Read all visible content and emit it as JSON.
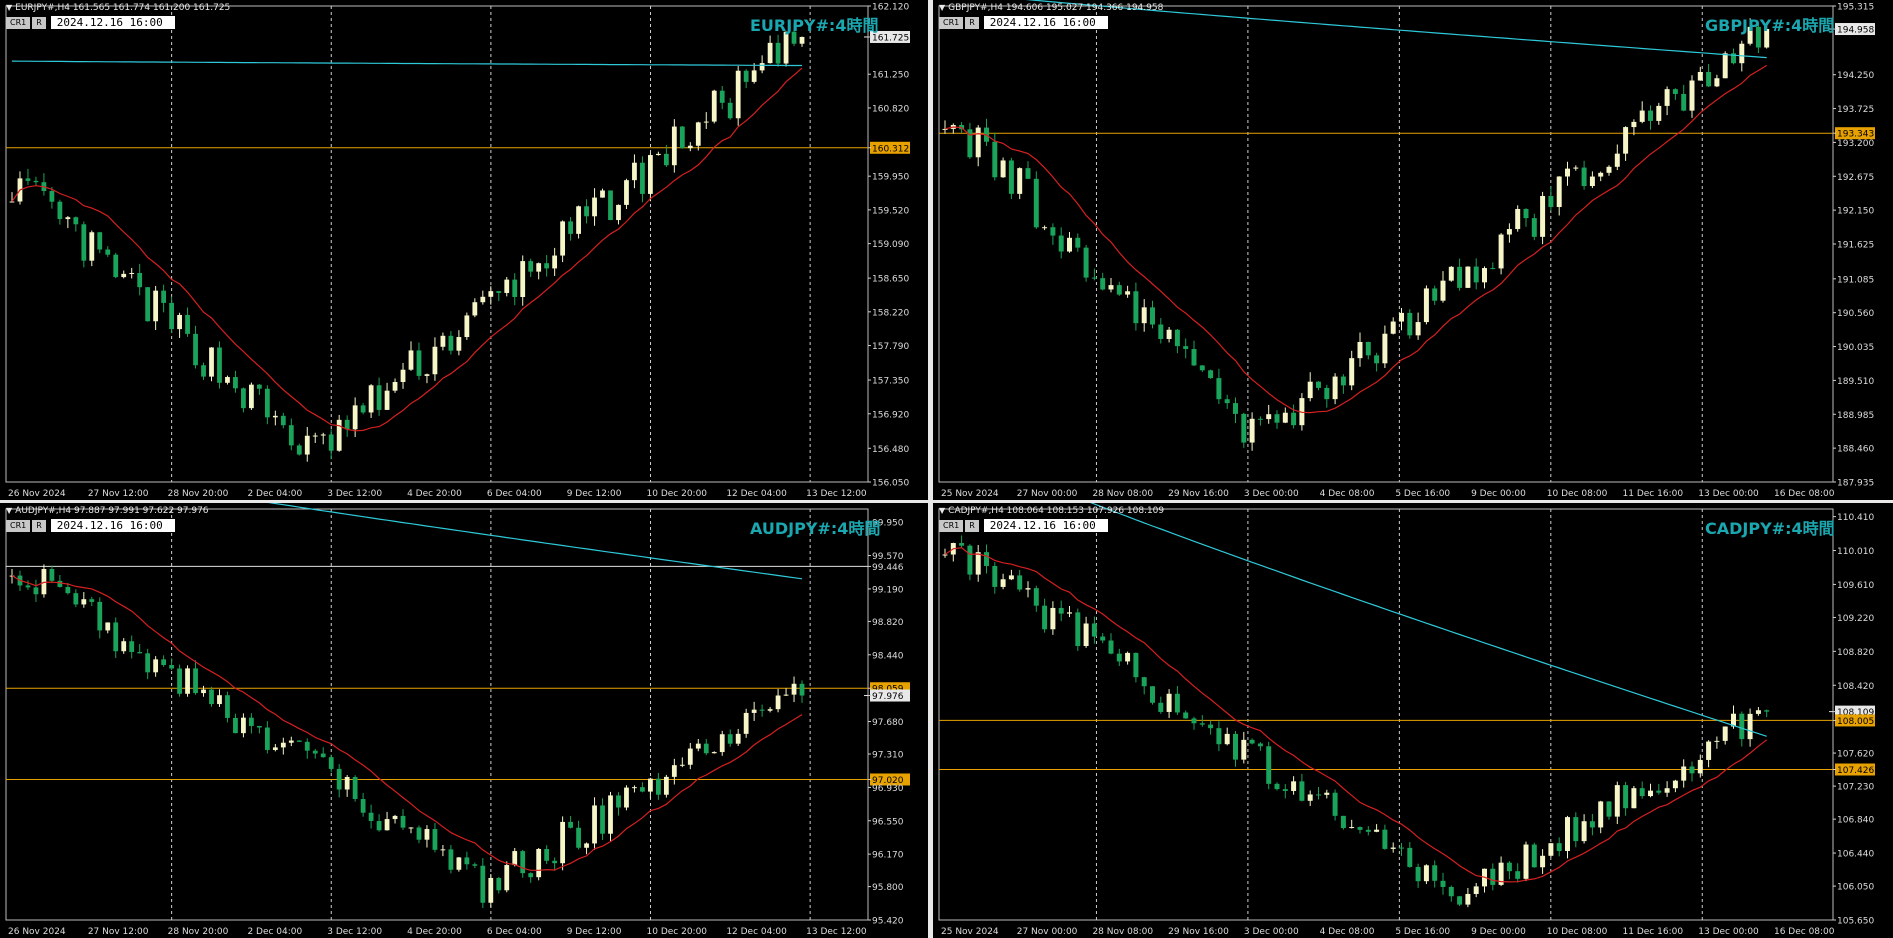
{
  "colors": {
    "up": "#f6f6c8",
    "down": "#1aa35a",
    "ma_fast": "#d62020",
    "ma_slow": "#2ec9d9",
    "hline": "#e8a200",
    "hline_white": "#e0e0e0",
    "grid": "#cfcfcf",
    "title": "#1aa7b0"
  },
  "panels": [
    {
      "id": "eurjpy",
      "ohlc": "EURJPY#,H4  161.565 161.774 161.200 161.725",
      "tag1": "CR1",
      "tag2": "R",
      "date": "2024.12.16 16:00",
      "title": "EURJPY#:4時間",
      "price_labels": [
        "162.120",
        "161.725",
        "161.250",
        "160.820",
        "160.312",
        "159.950",
        "159.520",
        "159.090",
        "158.650",
        "158.220",
        "157.790",
        "157.350",
        "156.920",
        "156.480",
        "156.050"
      ],
      "time_labels": [
        "26 Nov 2024",
        "27 Nov 12:00",
        "28 Nov 20:00",
        "2 Dec 04:00",
        "3 Dec 12:00",
        "4 Dec 20:00",
        "6 Dec 04:00",
        "9 Dec 12:00",
        "10 Dec 20:00",
        "12 Dec 04:00",
        "13 Dec 12:00"
      ],
      "current": "161.725",
      "hline": "160.312",
      "chart_data": {
        "type": "candlestick",
        "ylim": [
          156.05,
          162.12
        ],
        "last": 161.725,
        "hlines": [
          160.312
        ],
        "start": 159.9,
        "end": 161.725,
        "low_idx": 0.38,
        "low": 156.4
      }
    },
    {
      "id": "gbpjpy",
      "ohlc": "GBPJPY#,H4  194.606 195.027 194.366 194.958",
      "tag1": "CR1",
      "tag2": "R",
      "date": "2024.12.16 16:00",
      "title": "GBPJPY#:4時間",
      "price_labels": [
        "195.315",
        "194.958",
        "194.250",
        "193.725",
        "193.343",
        "193.200",
        "192.675",
        "192.150",
        "191.625",
        "191.085",
        "190.560",
        "190.035",
        "189.510",
        "188.985",
        "188.460",
        "187.935"
      ],
      "time_labels": [
        "25 Nov 2024",
        "27 Nov 00:00",
        "28 Nov 08:00",
        "29 Nov 16:00",
        "3 Dec 00:00",
        "4 Dec 08:00",
        "5 Dec 16:00",
        "9 Dec 00:00",
        "10 Dec 08:00",
        "11 Dec 16:00",
        "13 Dec 00:00",
        "16 Dec 08:00"
      ],
      "current": "194.958",
      "hline": "193.343",
      "chart_data": {
        "type": "candlestick",
        "ylim": [
          187.935,
          195.315
        ],
        "last": 194.958,
        "hlines": [
          193.343
        ],
        "start": 193.7,
        "end": 194.958,
        "low_idx": 0.38,
        "low": 188.6
      }
    },
    {
      "id": "audjpy",
      "ohlc": "AUDJPY#,H4  97.887 97.991 97.622 97.976",
      "tag1": "CR1",
      "tag2": "R",
      "date": "2024.12.16 16:00",
      "title": "AUDJPY#:4時間",
      "price_labels": [
        "99.950",
        "99.570",
        "99.446",
        "99.190",
        "98.820",
        "98.440",
        "98.059",
        "97.976",
        "97.680",
        "97.310",
        "97.020",
        "96.930",
        "96.550",
        "96.170",
        "95.800",
        "95.420"
      ],
      "time_labels": [
        "26 Nov 2024",
        "27 Nov 12:00",
        "28 Nov 20:00",
        "2 Dec 04:00",
        "3 Dec 12:00",
        "4 Dec 20:00",
        "6 Dec 04:00",
        "9 Dec 12:00",
        "10 Dec 20:00",
        "12 Dec 04:00",
        "13 Dec 12:00"
      ],
      "current": "97.976",
      "hline": "98.059",
      "hline2": "97.020",
      "hline_white": "99.446",
      "chart_data": {
        "type": "candlestick",
        "ylim": [
          95.42,
          100.1
        ],
        "last": 97.976,
        "hlines": [
          98.059,
          97.02,
          99.446
        ],
        "start": 99.5,
        "end": 97.976,
        "low_idx": 0.6,
        "low": 95.8
      }
    },
    {
      "id": "cadjpy",
      "ohlc": "CADJPY#,H4  108.064 108.153 107.926 108.109",
      "tag1": "CR1",
      "tag2": "R",
      "date": "2024.12.16 16:00",
      "title": "CADJPY#:4時間",
      "price_labels": [
        "110.410",
        "110.010",
        "109.610",
        "109.220",
        "108.820",
        "108.420",
        "108.109",
        "108.005",
        "107.620",
        "107.426",
        "107.230",
        "106.840",
        "106.440",
        "106.050",
        "105.650"
      ],
      "time_labels": [
        "25 Nov 2024",
        "27 Nov 00:00",
        "28 Nov 08:00",
        "29 Nov 16:00",
        "3 Dec 00:00",
        "4 Dec 08:00",
        "5 Dec 16:00",
        "9 Dec 00:00",
        "10 Dec 08:00",
        "11 Dec 16:00",
        "13 Dec 00:00",
        "16 Dec 08:00"
      ],
      "current": "108.109",
      "hline": "108.005",
      "hline2": "107.426",
      "chart_data": {
        "type": "candlestick",
        "ylim": [
          105.65,
          110.5
        ],
        "last": 108.109,
        "hlines": [
          108.005,
          107.426
        ],
        "start": 110.1,
        "end": 108.109,
        "low_idx": 0.62,
        "low": 105.9
      }
    }
  ]
}
